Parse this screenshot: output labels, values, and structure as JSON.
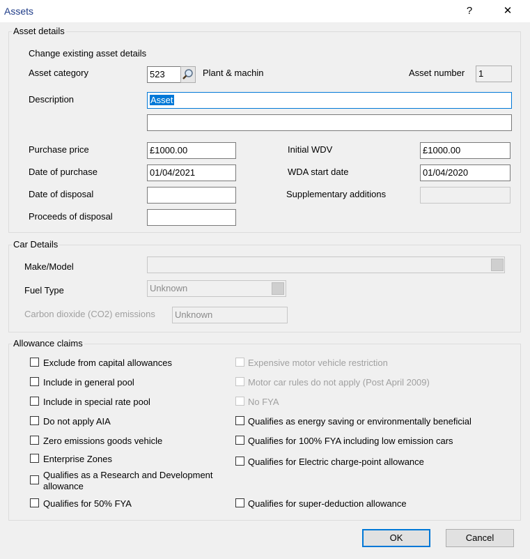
{
  "window": {
    "title": "Assets",
    "help_label": "?",
    "close_label": "✕"
  },
  "asset_details": {
    "legend": "Asset details",
    "subtitle": "Change existing asset details",
    "category_label": "Asset category",
    "category_value": "523",
    "category_name": "Plant & machin",
    "asset_number_label": "Asset number",
    "asset_number_value": "1",
    "description_label": "Description",
    "description_value": "Asset",
    "description2_value": "",
    "purchase_price_label": "Purchase price",
    "purchase_price_value": "£1000.00",
    "date_of_purchase_label": "Date of purchase",
    "date_of_purchase_value": "01/04/2021",
    "date_of_disposal_label": "Date of disposal",
    "date_of_disposal_value": "",
    "proceeds_label": "Proceeds of disposal",
    "proceeds_value": "",
    "initial_wdv_label": "Initial WDV",
    "initial_wdv_value": "£1000.00",
    "wda_start_label": "WDA start date",
    "wda_start_value": "01/04/2020",
    "supp_additions_label": "Supplementary additions",
    "supp_additions_value": ""
  },
  "car_details": {
    "legend": "Car Details",
    "make_model_label": "Make/Model",
    "make_model_value": "",
    "fuel_type_label": "Fuel Type",
    "fuel_type_value": "Unknown",
    "co2_label": "Carbon dioxide (CO2) emissions",
    "co2_value": "Unknown"
  },
  "allowance_claims": {
    "legend": "Allowance claims",
    "left": [
      {
        "label": "Exclude from capital allowances",
        "checked": false,
        "enabled": true
      },
      {
        "label": "Include in general pool",
        "checked": false,
        "enabled": true
      },
      {
        "label": "Include in special rate pool",
        "checked": false,
        "enabled": true
      },
      {
        "label": "Do not apply AIA",
        "checked": false,
        "enabled": true
      },
      {
        "label": "Zero emissions goods vehicle",
        "checked": false,
        "enabled": true
      },
      {
        "label": "Enterprise Zones",
        "checked": false,
        "enabled": true
      },
      {
        "label": "Qualifies as a Research and Development",
        "label2": "allowance",
        "checked": false,
        "enabled": true
      },
      {
        "label": "Qualifies for 50% FYA",
        "checked": false,
        "enabled": true
      }
    ],
    "right": [
      {
        "label": "Expensive motor vehicle restriction",
        "checked": false,
        "enabled": false
      },
      {
        "label": "Motor car rules do not apply (Post April 2009)",
        "checked": false,
        "enabled": false
      },
      {
        "label": "No FYA",
        "checked": false,
        "enabled": false
      },
      {
        "label": "Qualifies as energy saving or environmentally beneficial",
        "checked": false,
        "enabled": true
      },
      {
        "label": "Qualifies for 100% FYA including low emission cars",
        "checked": false,
        "enabled": true
      },
      {
        "label": "Qualifies for Electric charge-point allowance",
        "checked": false,
        "enabled": true
      },
      {
        "label": "Qualifies for super-deduction allowance",
        "checked": false,
        "enabled": true
      }
    ]
  },
  "buttons": {
    "ok_label": "OK",
    "cancel_label": "Cancel"
  }
}
